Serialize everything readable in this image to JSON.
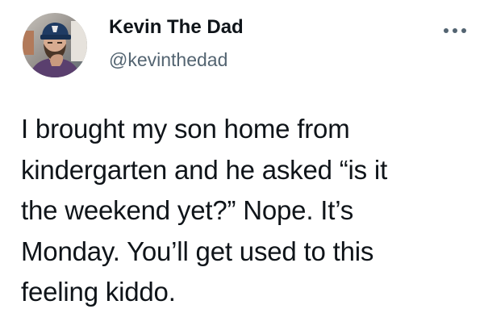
{
  "tweet": {
    "author": {
      "display_name": "Kevin The Dad",
      "handle": "@kevinthedad",
      "avatar_icon": "profile-photo"
    },
    "more_icon": "ellipsis-icon",
    "text": "I brought my son home from\nkindergarten and he asked “is it\nthe weekend yet?” Nope. It’s\nMonday. You’ll get used to this\nfeeling kiddo."
  },
  "colors": {
    "text_primary": "#0f1419",
    "text_secondary": "#536471",
    "background": "#ffffff"
  }
}
